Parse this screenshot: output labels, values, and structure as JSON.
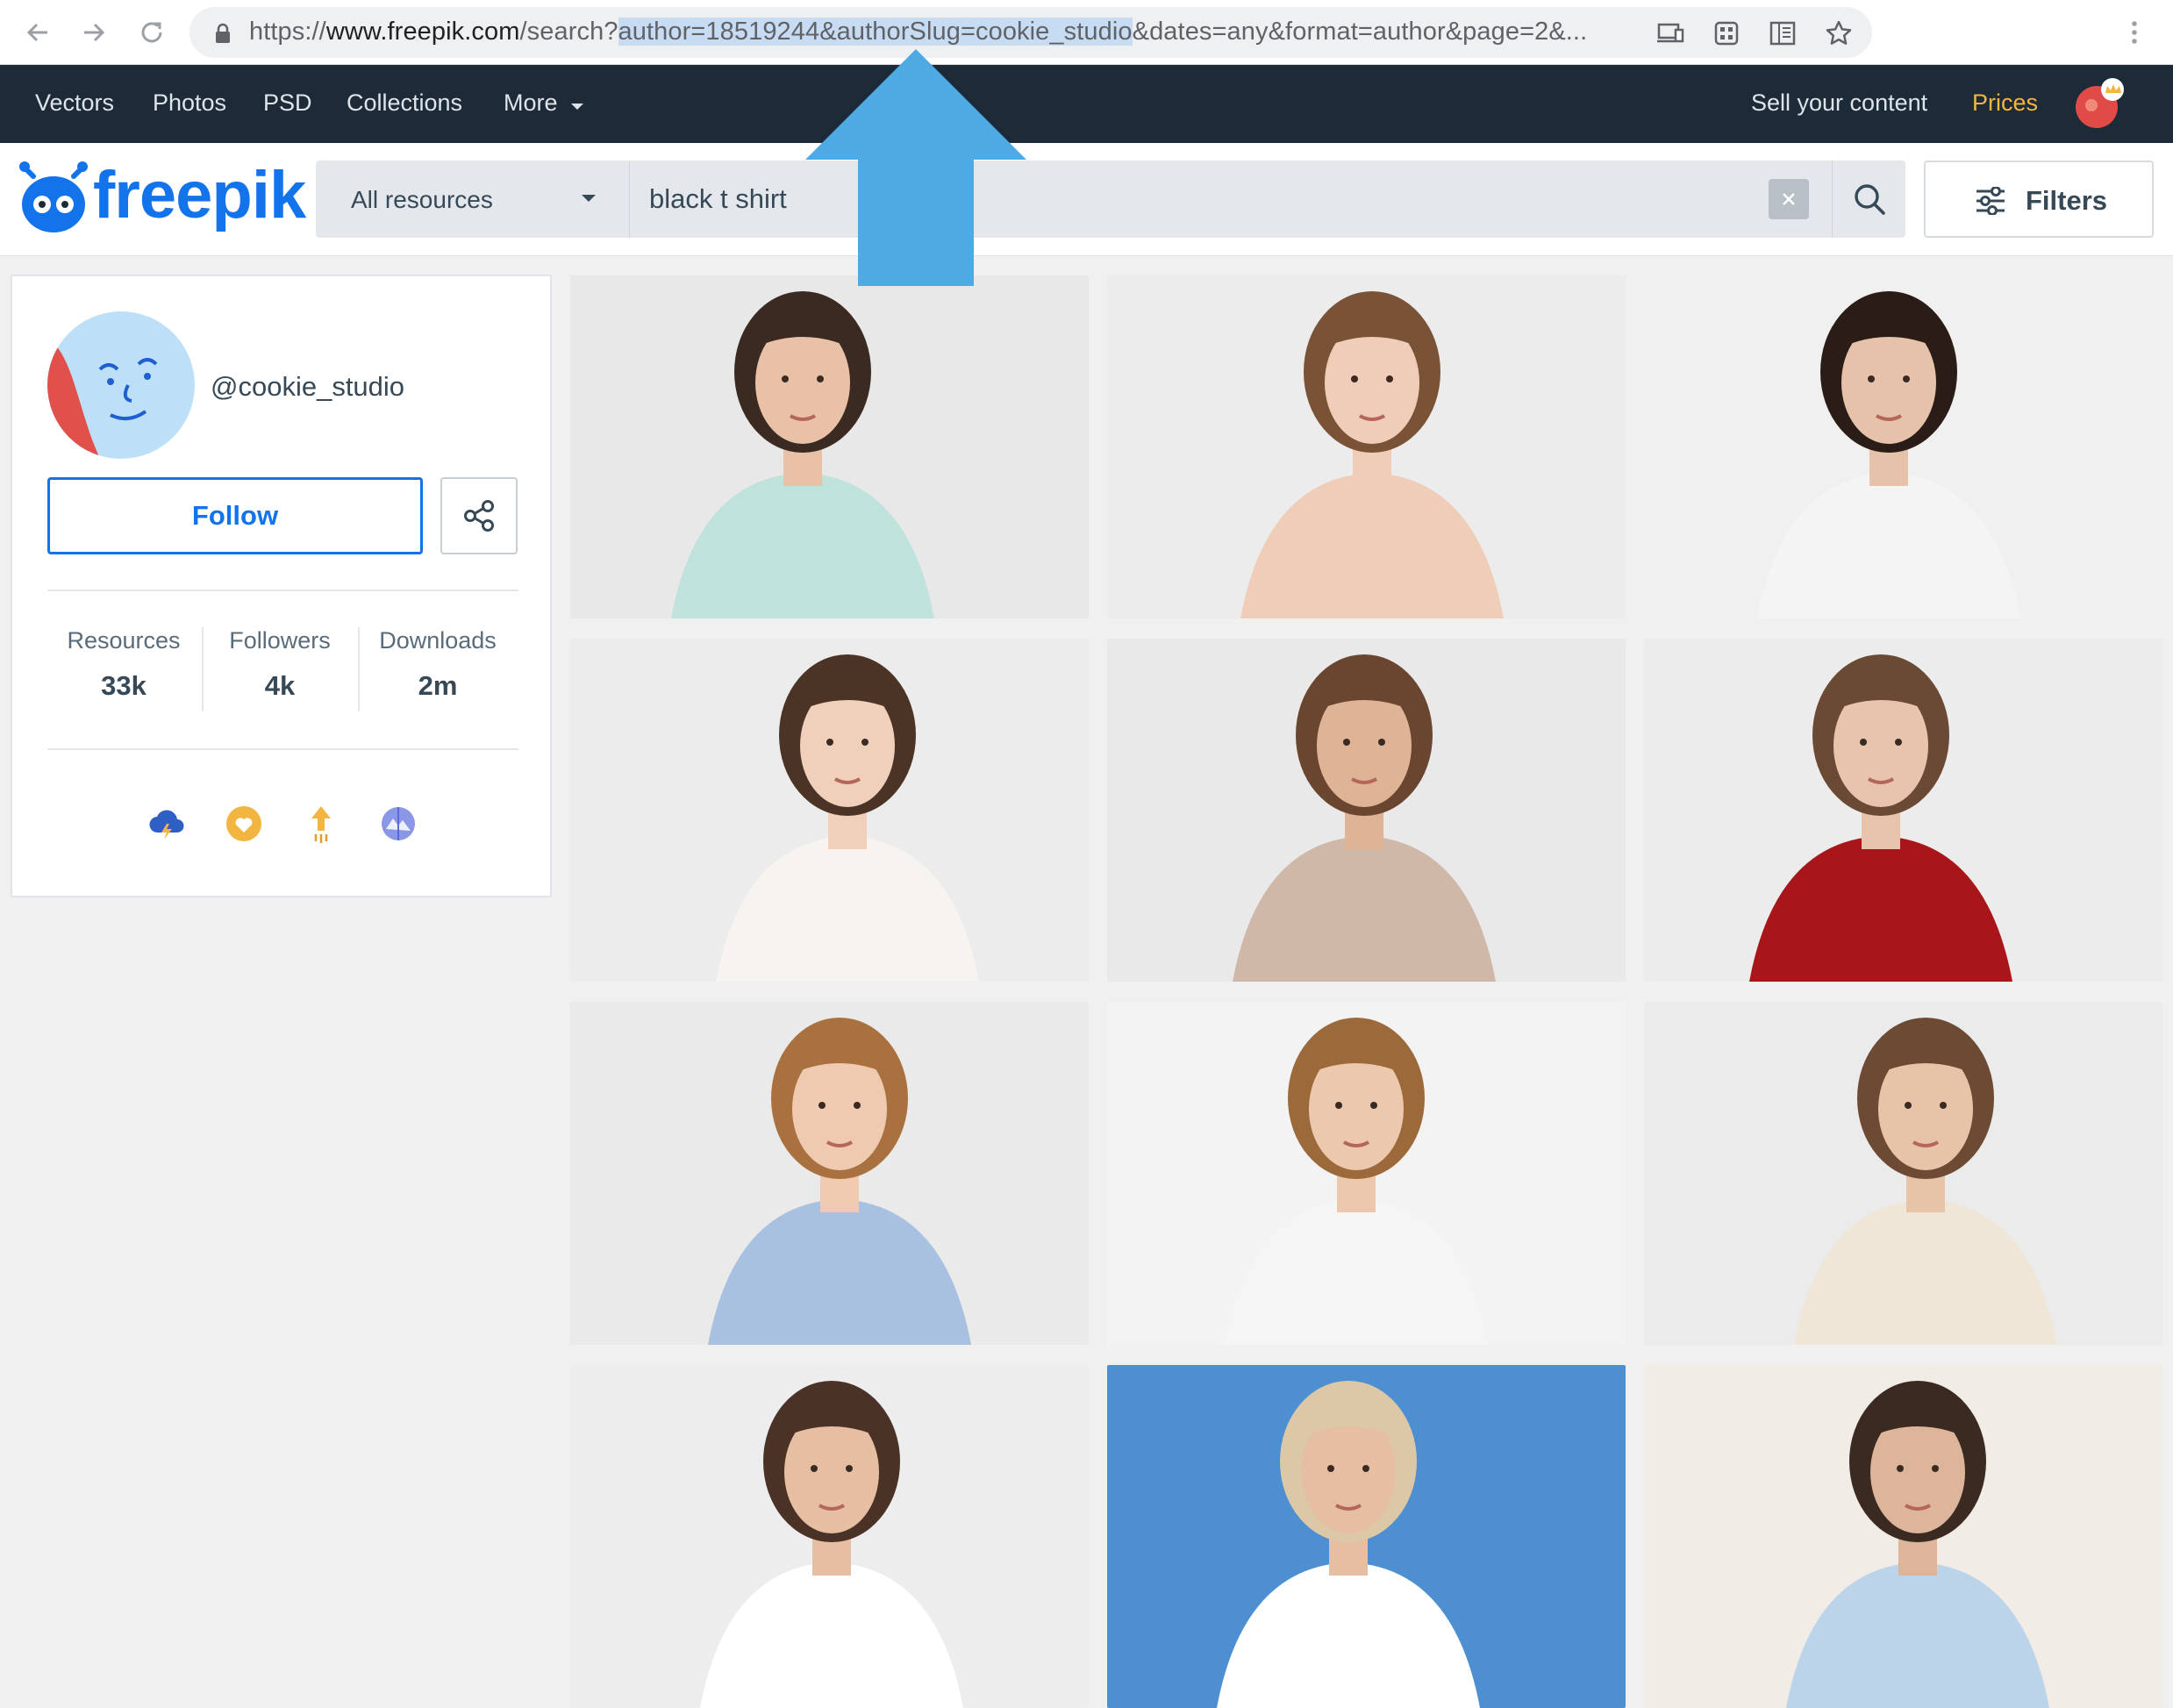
{
  "browser": {
    "url_prefix": "https://",
    "url_host": "www.freepik.com",
    "url_path": "/search?",
    "url_highlight": "author=18519244&authorSlug=cookie_studio",
    "url_rest": "&dates=any&format=author&page=2&..."
  },
  "topnav": {
    "items": [
      "Vectors",
      "Photos",
      "PSD",
      "Collections",
      "More"
    ],
    "sell": "Sell your content",
    "prices": "Prices"
  },
  "header": {
    "logo": "freepik",
    "resource_select": "All resources",
    "search_value": "black t shirt",
    "filters": "Filters"
  },
  "profile": {
    "handle": "@cookie_studio",
    "follow": "Follow",
    "stats": [
      {
        "label": "Resources",
        "value": "33k"
      },
      {
        "label": "Followers",
        "value": "4k"
      },
      {
        "label": "Downloads",
        "value": "2m"
      }
    ],
    "badges": [
      "cloud-badge-icon",
      "heart-badge-icon",
      "upload-badge-icon",
      "globe-badge-icon"
    ]
  },
  "colors": {
    "brand": "#1273eb",
    "nav_bg": "#1d2a37",
    "prices": "#f2b640",
    "annotation_arrow": "#4fa9e3"
  },
  "gallery": {
    "tiles": [
      {
        "bg": "#e8e8e8",
        "skin": "#e8c1a6",
        "hair": "#3a2a22",
        "shirt": "#bfe3dc"
      },
      {
        "bg": "#ececec",
        "skin": "#efcdb8",
        "hair": "#7a5236",
        "shirt": "#efcdb8"
      },
      {
        "bg": "#f0f0f0",
        "skin": "#e6c2aa",
        "hair": "#2a1d17",
        "shirt": "#f4f4f4"
      },
      {
        "bg": "#ececec",
        "skin": "#f0cfbb",
        "hair": "#4b3325",
        "shirt": "#f7f4ef"
      },
      {
        "bg": "#e9e9e9",
        "skin": "#dfb496",
        "hair": "#6a4630",
        "shirt": "#cfb8a8"
      },
      {
        "bg": "#ececec",
        "skin": "#e8c4ad",
        "hair": "#6b4a35",
        "shirt": "#a8161a"
      },
      {
        "bg": "#eaeaea",
        "skin": "#efcab1",
        "hair": "#a8713f",
        "shirt": "#a9c1e0"
      },
      {
        "bg": "#f3f3f3",
        "skin": "#ecc8ae",
        "hair": "#9c6a3a",
        "shirt": "#f5f5f5"
      },
      {
        "bg": "#ebebeb",
        "skin": "#e7c3a8",
        "hair": "#6d4a34",
        "shirt": "#efe6d8"
      },
      {
        "bg": "#ededed",
        "skin": "#e6bfa2",
        "hair": "#4a3326",
        "shirt": "#ffffff"
      },
      {
        "bg": "#4d8fd0",
        "skin": "#e6bfa2",
        "hair": "#dcc8a6",
        "shirt": "#ffffff"
      },
      {
        "bg": "#f1ece6",
        "skin": "#dcb59a",
        "hair": "#3a2a22",
        "shirt": "#bcd4ea"
      }
    ]
  }
}
